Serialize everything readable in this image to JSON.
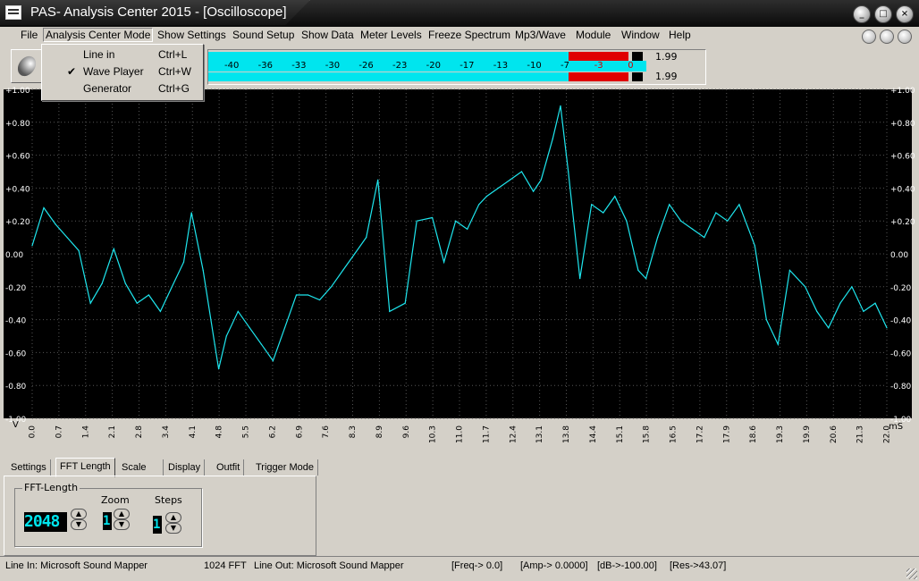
{
  "window": {
    "title": "PAS- Analysis Center 2015 - [Oscilloscope]",
    "controls": [
      "_",
      "□",
      "×"
    ]
  },
  "menu": [
    {
      "label": "File",
      "key": "file"
    },
    {
      "label": "Analysis Center Mode",
      "key": "mode"
    },
    {
      "label": "Show Settings",
      "key": "settings"
    },
    {
      "label": "Sound Setup",
      "key": "sound"
    },
    {
      "label": "Show Data",
      "key": "data"
    },
    {
      "label": "Meter Levels",
      "key": "meter"
    },
    {
      "label": "Freeze Spectrum",
      "key": "freeze"
    },
    {
      "label": "Mp3/Wave",
      "key": "mp3"
    },
    {
      "label": "Module",
      "key": "module"
    },
    {
      "label": "Window",
      "key": "window"
    },
    {
      "label": "Help",
      "key": "help"
    }
  ],
  "dropdown": [
    {
      "label": "Line in",
      "shortcut": "Ctrl+L",
      "checked": ""
    },
    {
      "label": "Wave Player",
      "shortcut": "Ctrl+W",
      "checked": "✔"
    },
    {
      "label": "Generator",
      "shortcut": "Ctrl+G",
      "checked": ""
    }
  ],
  "meter": {
    "scale": [
      "-40",
      "-36",
      "-33",
      "-30",
      "-26",
      "-23",
      "-20",
      "-17",
      "-13",
      "-10",
      "-7",
      "-3",
      "0"
    ],
    "top_value": "1.99",
    "bottom_value": "1.99",
    "level_fraction": 0.96
  },
  "chart_data": {
    "type": "line",
    "y_ticks": [
      "+1.00",
      "+0.80",
      "+0.60",
      "+0.40",
      "+0.20",
      "0.00",
      "-0.20",
      "-0.40",
      "-0.60",
      "-0.80",
      "-1.00"
    ],
    "x_ticks": [
      "0.0",
      "0.7",
      "1.4",
      "2.1",
      "2.8",
      "3.4",
      "4.1",
      "4.8",
      "5.5",
      "6.2",
      "6.9",
      "7.6",
      "8.3",
      "8.9",
      "9.6",
      "10.3",
      "11.0",
      "11.7",
      "12.4",
      "13.1",
      "13.8",
      "14.4",
      "15.1",
      "15.8",
      "16.5",
      "17.2",
      "17.9",
      "18.6",
      "19.3",
      "19.9",
      "20.6",
      "21.3",
      "22.0"
    ],
    "xlabel": "mS",
    "ylabel": "V",
    "ylim": [
      -1.0,
      1.0
    ],
    "xlim": [
      0.0,
      22.0
    ],
    "series_color": "#1ee6ee",
    "grid": true,
    "x": [
      0.0,
      0.3,
      0.6,
      0.9,
      1.2,
      1.5,
      1.8,
      2.1,
      2.4,
      2.7,
      3.0,
      3.3,
      3.6,
      3.9,
      4.1,
      4.4,
      4.7,
      4.8,
      5.0,
      5.3,
      5.6,
      5.9,
      6.2,
      6.5,
      6.8,
      7.1,
      7.4,
      7.7,
      8.0,
      8.3,
      8.6,
      8.9,
      9.2,
      9.6,
      9.9,
      10.3,
      10.6,
      10.9,
      11.2,
      11.5,
      11.7,
      12.0,
      12.3,
      12.6,
      12.9,
      13.1,
      13.4,
      13.6,
      13.8,
      14.1,
      14.4,
      14.7,
      15.0,
      15.3,
      15.6,
      15.8,
      16.1,
      16.4,
      16.7,
      17.0,
      17.3,
      17.6,
      17.9,
      18.2,
      18.6,
      18.9,
      19.2,
      19.5,
      19.9,
      20.2,
      20.5,
      20.8,
      21.1,
      21.4,
      21.7,
      22.0
    ],
    "y": [
      0.05,
      0.28,
      0.18,
      0.1,
      0.02,
      -0.3,
      -0.18,
      0.03,
      -0.18,
      -0.3,
      -0.25,
      -0.35,
      -0.2,
      -0.05,
      0.25,
      -0.1,
      -0.55,
      -0.7,
      -0.5,
      -0.35,
      -0.45,
      -0.55,
      -0.65,
      -0.45,
      -0.25,
      -0.25,
      -0.28,
      -0.2,
      -0.1,
      0.0,
      0.1,
      0.45,
      -0.35,
      -0.3,
      0.2,
      0.22,
      -0.05,
      0.2,
      0.15,
      0.3,
      0.35,
      0.4,
      0.45,
      0.5,
      0.38,
      0.45,
      0.7,
      0.9,
      0.5,
      -0.15,
      0.3,
      0.25,
      0.35,
      0.2,
      -0.1,
      -0.15,
      0.1,
      0.3,
      0.2,
      0.15,
      0.1,
      0.25,
      0.2,
      0.3,
      0.05,
      -0.4,
      -0.55,
      -0.1,
      -0.2,
      -0.35,
      -0.45,
      -0.3,
      -0.2,
      -0.35,
      -0.3,
      -0.45
    ]
  },
  "settings_tabs": [
    {
      "label": "Settings"
    },
    {
      "label": "FFT Length"
    },
    {
      "label": "Scale"
    },
    {
      "label": "Display"
    },
    {
      "label": "Outfit"
    },
    {
      "label": "Trigger Mode"
    }
  ],
  "fft": {
    "group_title": "FFT-Length",
    "value": "2048",
    "zoom_label": "Zoom",
    "zoom_value": "1",
    "steps_label": "Steps",
    "steps_value": "1"
  },
  "status": {
    "line_in": "Line In: Microsoft Sound Mapper",
    "fft": "1024 FFT",
    "line_out": "Line Out: Microsoft Sound Mapper",
    "freq": "[Freq->     0.0]",
    "amp": "[Amp-> 0.0000]",
    "db": "[dB->-100.00]",
    "res": "[Res->43.07]"
  }
}
